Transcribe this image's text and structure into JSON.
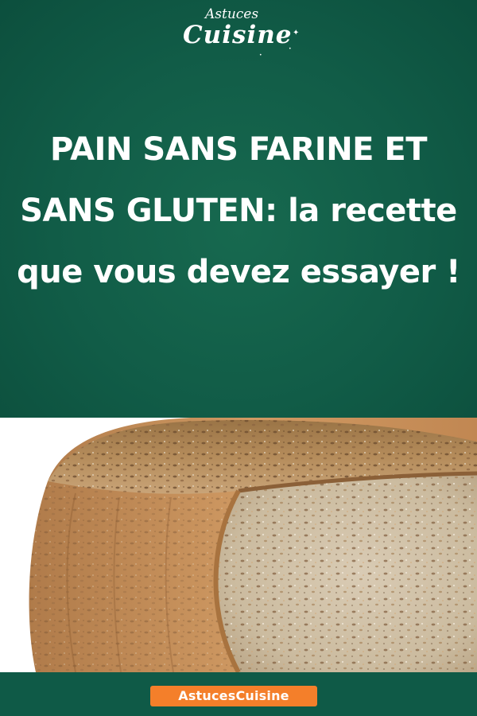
{
  "logo": {
    "line1": "Astuces",
    "line2": "Cuisine"
  },
  "headline": {
    "part1": "PAIN SANS FARINE ET SANS GLUTEN:",
    "part2": " la recette que vous devez essayer !"
  },
  "photo": {
    "subject": "seeded-bread-loaf"
  },
  "footer": {
    "badge": "AstucesCuisine",
    "badge_color": "#f47f2a"
  },
  "colors": {
    "background": "#0f5a47",
    "text": "#ffffff"
  }
}
